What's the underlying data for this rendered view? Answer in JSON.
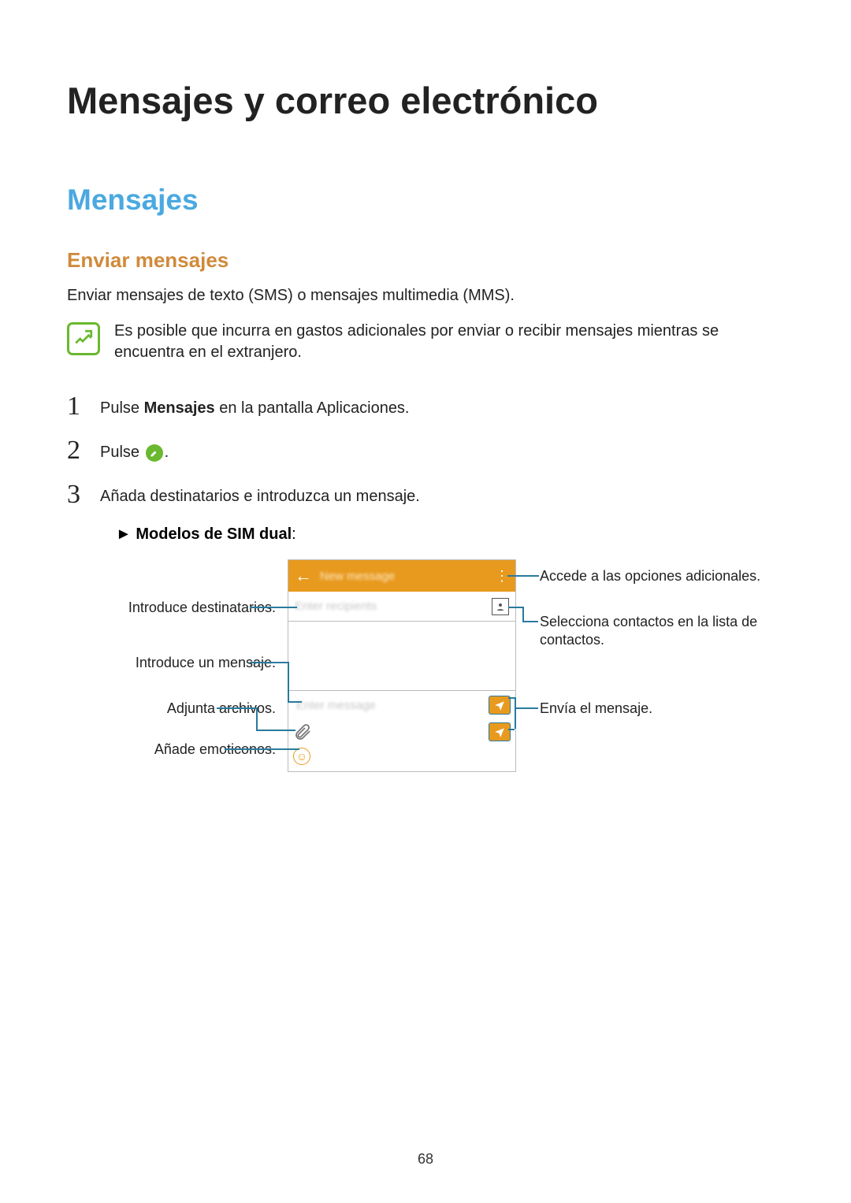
{
  "title": "Mensajes y correo electrónico",
  "section": "Mensajes",
  "subsection": "Enviar mensajes",
  "intro": "Enviar mensajes de texto (SMS) o mensajes multimedia (MMS).",
  "note": "Es posible que incurra en gastos adicionales por enviar o recibir mensajes mientras se encuentra en el extranjero.",
  "steps": {
    "s1_pre": "Pulse ",
    "s1_bold": "Mensajes",
    "s1_post": " en la pantalla Aplicaciones.",
    "s2_pre": "Pulse ",
    "s2_post": ".",
    "s3": "Añada destinatarios e introduzca un mensaje.",
    "s3_sub_marker": "► ",
    "s3_sub_bold": "Modelos de SIM dual",
    "s3_sub_colon": ":"
  },
  "nums": {
    "n1": "1",
    "n2": "2",
    "n3": "3"
  },
  "phone": {
    "header": "New message",
    "recipients": "Enter recipients",
    "enter_msg": "Enter message"
  },
  "callouts": {
    "left1": "Introduce destinatarios.",
    "left2": "Introduce un mensaje.",
    "left3": "Adjunta archivos.",
    "left4": "Añade emoticonos.",
    "right1": "Accede a las opciones adicionales.",
    "right2": "Selecciona contactos en la lista de contactos.",
    "right3": "Envía el mensaje."
  },
  "page_number": "68"
}
